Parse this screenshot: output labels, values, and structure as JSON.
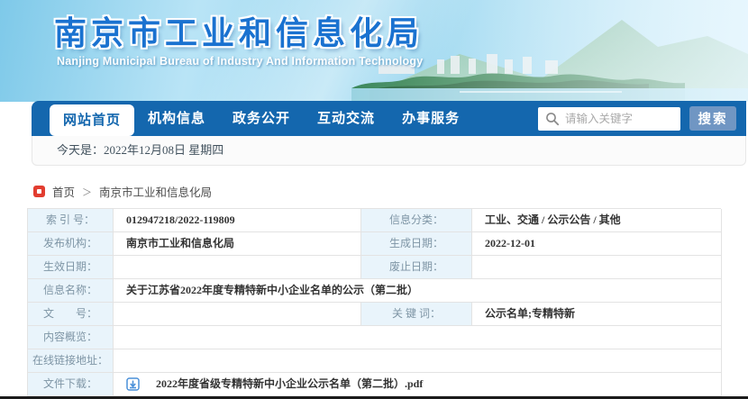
{
  "header": {
    "title": "南京市工业和信息化局",
    "subtitle": "Nanjing Municipal Bureau of Industry And Information Technology"
  },
  "nav": {
    "tabs": [
      {
        "label": "网站首页",
        "active": true
      },
      {
        "label": "机构信息",
        "active": false
      },
      {
        "label": "政务公开",
        "active": false
      },
      {
        "label": "互动交流",
        "active": false
      },
      {
        "label": "办事服务",
        "active": false
      }
    ],
    "search": {
      "placeholder": "请输入关键字",
      "button": "搜索",
      "icon": "search-icon"
    }
  },
  "datebar": {
    "text": "今天是：2022年12月08日  星期四"
  },
  "breadcrumb": {
    "icon": "home-marker-icon",
    "home": "首页",
    "separator": "＞",
    "current": "南京市工业和信息化局"
  },
  "info_table": {
    "rows": [
      {
        "cells": [
          {
            "label": "索 引 号：",
            "value": "012947218/2022-119809"
          },
          {
            "label": "信息分类：",
            "value": "工业、交通 / 公示公告 / 其他"
          }
        ]
      },
      {
        "cells": [
          {
            "label": "发布机构：",
            "value": "南京市工业和信息化局"
          },
          {
            "label": "生成日期：",
            "value": "2022-12-01"
          }
        ]
      },
      {
        "cells": [
          {
            "label": "生效日期：",
            "value": ""
          },
          {
            "label": "废止日期：",
            "value": ""
          }
        ]
      },
      {
        "span": true,
        "cells": [
          {
            "label": "信息名称：",
            "value": "关于江苏省2022年度专精特新中小企业名单的公示（第二批）"
          }
        ]
      },
      {
        "cells": [
          {
            "label": "文　　号：",
            "value": ""
          },
          {
            "label": "关 键 词：",
            "value": "公示名单;专精特新"
          }
        ]
      },
      {
        "span": true,
        "cells": [
          {
            "label": "内容概览：",
            "value": ""
          }
        ]
      },
      {
        "span": true,
        "cells": [
          {
            "label": "在线链接地址：",
            "value": ""
          }
        ]
      },
      {
        "span": true,
        "file": true,
        "cells": [
          {
            "label": "文件下载：",
            "value": "2022年度省级专精特新中小企业公示名单（第二批）.pdf"
          }
        ]
      }
    ],
    "download_icon": "download-icon"
  },
  "colors": {
    "nav_blue": "#1467ae",
    "title_blue": "#1a72d0",
    "label_cell_bg": "#e9f4fb",
    "label_text": "#7e95a5",
    "breadcrumb_icon_red": "#e23d30",
    "download_icon_blue": "#4a90d9",
    "search_button_bg": "#7096c3"
  }
}
